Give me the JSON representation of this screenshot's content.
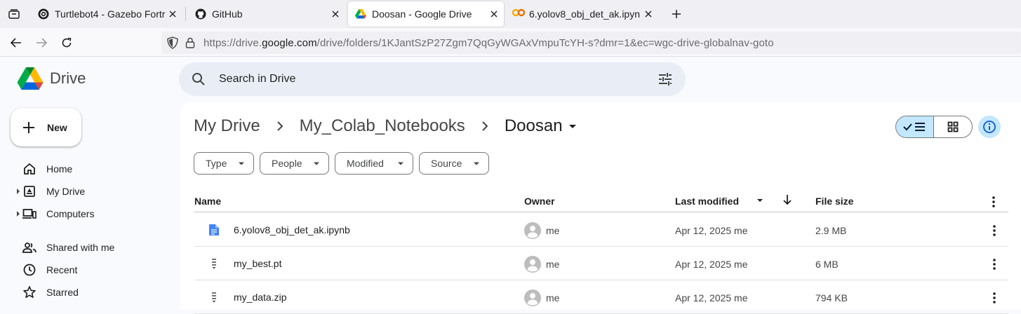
{
  "browser": {
    "tabs": [
      {
        "title": "Turtlebot4 - Gazebo Fortre",
        "favicon": "turtlebot-icon",
        "active": false
      },
      {
        "title": "GitHub",
        "favicon": "github-icon",
        "active": false
      },
      {
        "title": "Doosan - Google Drive",
        "favicon": "google-drive-icon",
        "active": true
      },
      {
        "title": "6.yolov8_obj_det_ak.ipyn",
        "favicon": "colab-icon",
        "active": false
      }
    ],
    "url_prefix": "https://drive.",
    "url_domain": "google.com",
    "url_rest": "/drive/folders/1KJantSzP27Zgm7QqGyWGAxVmpuTcYH-s?dmr=1&ec=wgc-drive-globalnav-goto"
  },
  "drive": {
    "logo_text": "Drive",
    "search_placeholder": "Search in Drive",
    "new_label": "New",
    "sidebar": [
      {
        "label": "Home",
        "icon": "home-icon",
        "expandable": false
      },
      {
        "label": "My Drive",
        "icon": "my-drive-icon",
        "expandable": true
      },
      {
        "label": "Computers",
        "icon": "computers-icon",
        "expandable": true
      },
      {
        "label": "Shared with me",
        "icon": "shared-icon",
        "expandable": false
      },
      {
        "label": "Recent",
        "icon": "clock-icon",
        "expandable": false
      },
      {
        "label": "Starred",
        "icon": "star-icon",
        "expandable": false
      }
    ],
    "breadcrumb": [
      "My Drive",
      "My_Colab_Notebooks",
      "Doosan"
    ],
    "filters": [
      "Type",
      "People",
      "Modified",
      "Source"
    ],
    "columns": {
      "name": "Name",
      "owner": "Owner",
      "modified": "Last modified",
      "size": "File size"
    },
    "files": [
      {
        "name": "6.yolov8_obj_det_ak.ipynb",
        "icon": "doc-icon",
        "owner": "me",
        "modified": "Apr 12, 2025 me",
        "size": "2.9 MB"
      },
      {
        "name": "my_best.pt",
        "icon": "file-generic-icon",
        "owner": "me",
        "modified": "Apr 12, 2025 me",
        "size": "6 MB"
      },
      {
        "name": "my_data.zip",
        "icon": "file-generic-icon",
        "owner": "me",
        "modified": "Apr 12, 2025 me",
        "size": "794 KB"
      }
    ],
    "colors": {
      "accent": "#0b57d0",
      "selected": "#c2e7ff",
      "search_bg": "#e9eef6"
    }
  }
}
